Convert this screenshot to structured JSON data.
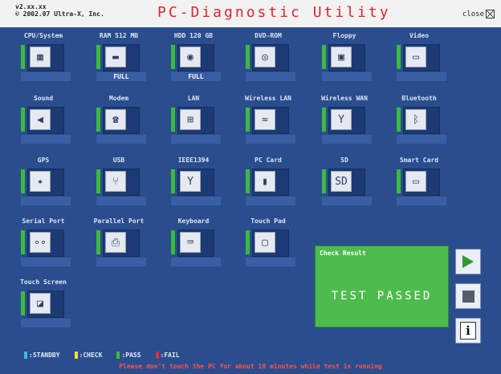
{
  "header": {
    "version": "v2.xx.xx",
    "copyright": "© 2002.07 Ultra-X, Inc.",
    "title": "PC-Diagnostic Utility",
    "close_label": "close"
  },
  "devices": [
    {
      "label": "CPU/System",
      "icon": "cpu-board-icon",
      "glyph": "▦",
      "status": ""
    },
    {
      "label": "RAM 512 MB",
      "icon": "ram-icon",
      "glyph": "▬",
      "status": "FULL"
    },
    {
      "label": "HDD 120 GB",
      "icon": "hdd-icon",
      "glyph": "◉",
      "status": "FULL"
    },
    {
      "label": "DVD-ROM",
      "icon": "disc-icon",
      "glyph": "◎",
      "status": ""
    },
    {
      "label": "Floppy",
      "icon": "floppy-icon",
      "glyph": "▣",
      "status": ""
    },
    {
      "label": "Video",
      "icon": "monitor-icon",
      "glyph": "▭",
      "status": ""
    },
    {
      "label": "Sound",
      "icon": "speaker-icon",
      "glyph": "◀",
      "status": ""
    },
    {
      "label": "Modem",
      "icon": "modem-icon",
      "glyph": "☎",
      "status": ""
    },
    {
      "label": "LAN",
      "icon": "network-icon",
      "glyph": "⊞",
      "status": ""
    },
    {
      "label": "Wireless LAN",
      "icon": "wireless-lan-icon",
      "glyph": "≈",
      "status": ""
    },
    {
      "label": "Wireless WAN",
      "icon": "antenna-icon",
      "glyph": "Y",
      "status": ""
    },
    {
      "label": "Bluetooth",
      "icon": "bluetooth-icon",
      "glyph": "ᛒ",
      "status": ""
    },
    {
      "label": "GPS",
      "icon": "satellite-icon",
      "glyph": "✦",
      "status": ""
    },
    {
      "label": "USB",
      "icon": "usb-icon",
      "glyph": "⑂",
      "status": ""
    },
    {
      "label": "IEEE1394",
      "icon": "firewire-icon",
      "glyph": "Y",
      "status": ""
    },
    {
      "label": "PC Card",
      "icon": "pc-card-icon",
      "glyph": "▮",
      "status": ""
    },
    {
      "label": "SD",
      "icon": "sd-card-icon",
      "glyph": "SD",
      "status": ""
    },
    {
      "label": "Smart Card",
      "icon": "smart-card-icon",
      "glyph": "▭",
      "status": ""
    },
    {
      "label": "Serial Port",
      "icon": "serial-port-icon",
      "glyph": "∘∘",
      "status": ""
    },
    {
      "label": "Parallel Port",
      "icon": "printer-icon",
      "glyph": "⎙",
      "status": ""
    },
    {
      "label": "Keyboard",
      "icon": "keyboard-icon",
      "glyph": "⌨",
      "status": ""
    },
    {
      "label": "Touch Pad",
      "icon": "touchpad-icon",
      "glyph": "▢",
      "status": ""
    },
    {
      "label": "Touch Screen",
      "icon": "touch-screen-icon",
      "glyph": "◪",
      "status": ""
    }
  ],
  "result": {
    "label": "Check Result",
    "text": "TEST PASSED"
  },
  "legend": [
    {
      "label": ":STANDBY",
      "color": "#3fb6f0"
    },
    {
      "label": ":CHECK",
      "color": "#f0e23a"
    },
    {
      "label": ":PASS",
      "color": "#3bbb3b"
    },
    {
      "label": ":FAIL",
      "color": "#e03030"
    }
  ],
  "warning": "Please don't touch the PC for about 10 minutes while test is running"
}
